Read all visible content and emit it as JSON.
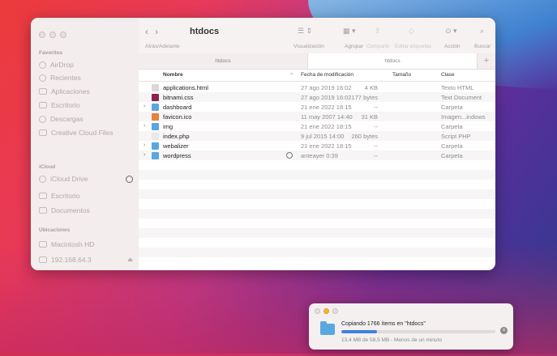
{
  "window": {
    "title": "htdocs"
  },
  "sidebar": {
    "favorites_header": "Favoritos",
    "favorites": [
      {
        "label": "AirDrop",
        "icon": "airdrop-icon"
      },
      {
        "label": "Recientes",
        "icon": "clock-icon"
      },
      {
        "label": "Aplicaciones",
        "icon": "applications-icon"
      },
      {
        "label": "Escritorio",
        "icon": "desktop-icon"
      },
      {
        "label": "Descargas",
        "icon": "download-icon"
      },
      {
        "label": "Creative Cloud Files",
        "icon": "document-icon"
      }
    ],
    "icloud_header": "iCloud",
    "icloud": [
      {
        "label": "iCloud Drive",
        "icon": "cloud-icon"
      },
      {
        "label": "Escritorio",
        "icon": "desktop-icon"
      },
      {
        "label": "Documentos",
        "icon": "document-icon"
      }
    ],
    "locations_header": "Ubicaciones",
    "locations": [
      {
        "label": "Macintosh HD",
        "icon": "disk-icon"
      },
      {
        "label": "192.168.64.3",
        "icon": "network-icon"
      }
    ]
  },
  "toolbar": {
    "nav_label": "Atrás/Adelante",
    "view_label": "Visualización",
    "group_label": "Agrupar",
    "share_label": "Compartir",
    "tags_label": "Editar etiquetas",
    "action_label": "Acción",
    "search_label": "Buscar"
  },
  "tabs": [
    {
      "label": "htdocs"
    },
    {
      "label": "htdocs"
    }
  ],
  "columns": {
    "name": "Nombre",
    "modified": "Fecha de modificación",
    "size": "Tamaño",
    "kind": "Clase"
  },
  "files": [
    {
      "name": "applications.html",
      "modified": "27 ago 2019 16:02",
      "size": "4 KB",
      "kind": "Texto HTML",
      "type": "file"
    },
    {
      "name": "bitnami.css",
      "modified": "27 ago 2019 16:02",
      "size": "177 bytes",
      "kind": "Text Document",
      "type": "css"
    },
    {
      "name": "dashboard",
      "modified": "21 ene 2022 18:15",
      "size": "--",
      "kind": "Carpeta",
      "type": "folder"
    },
    {
      "name": "favicon.ico",
      "modified": "11 may 2007 14:40",
      "size": "31 KB",
      "kind": "Imagen...indows",
      "type": "ico"
    },
    {
      "name": "img",
      "modified": "21 ene 2022 18:15",
      "size": "--",
      "kind": "Carpeta",
      "type": "folder"
    },
    {
      "name": "index.php",
      "modified": "9 jul 2015 14:00",
      "size": "260 bytes",
      "kind": "Script PHP",
      "type": "php"
    },
    {
      "name": "webalizer",
      "modified": "21 ene 2022 18:15",
      "size": "--",
      "kind": "Carpeta",
      "type": "folder"
    },
    {
      "name": "wordpress",
      "modified": "anteayer 0:39",
      "size": "--",
      "kind": "Carpeta",
      "type": "folder"
    }
  ],
  "copy_dialog": {
    "title": "Copiando 1766 ítems en \"htdocs\"",
    "subtitle": "13,4 MB de 58,5 MB - Menos de un minuto",
    "progress": 0.23
  }
}
